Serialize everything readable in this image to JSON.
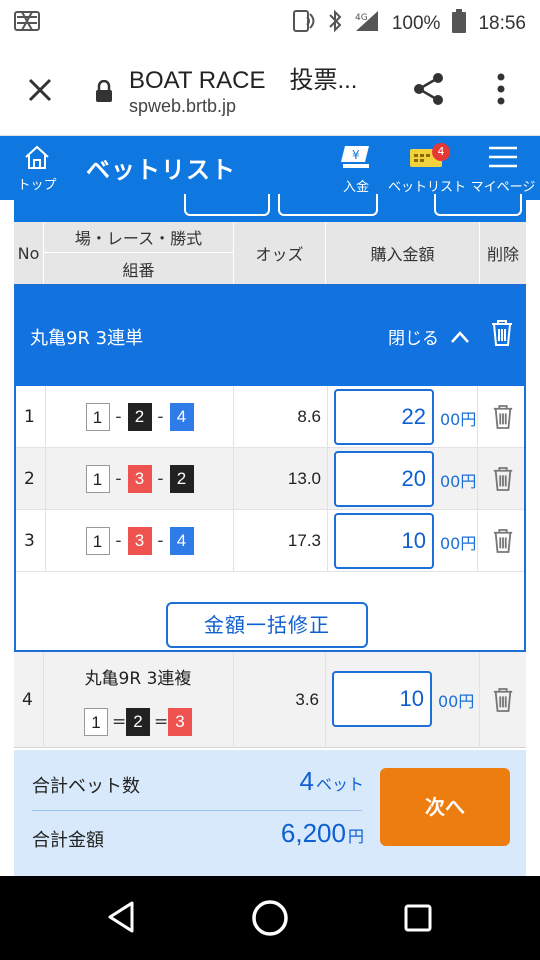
{
  "status_bar": {
    "battery_pct": "100%",
    "clock": "18:56",
    "network": "4G"
  },
  "browser": {
    "title": "BOAT RACE　投票...",
    "url": "spweb.brtb.jp"
  },
  "header": {
    "top_label": "トップ",
    "title": "ベットリスト",
    "deposit_label": "入金",
    "betlist_label": "ベットリスト",
    "betlist_badge": "4",
    "mypage_label": "マイページ"
  },
  "table_head": {
    "no": "No",
    "place_race_type": "場・レース・勝式",
    "combination": "組番",
    "odds": "オッズ",
    "amount": "購入金額",
    "delete": "削除"
  },
  "group": {
    "title": "丸亀9R 3連単",
    "close_label": "閉じる",
    "rows": [
      {
        "no": "1",
        "boats": [
          "1",
          "2",
          "4"
        ],
        "odds": "8.6",
        "amount": "22",
        "unit": "00円"
      },
      {
        "no": "2",
        "boats": [
          "1",
          "3",
          "2"
        ],
        "odds": "13.0",
        "amount": "20",
        "unit": "00円"
      },
      {
        "no": "3",
        "boats": [
          "1",
          "3",
          "4"
        ],
        "odds": "17.3",
        "amount": "10",
        "unit": "00円"
      }
    ],
    "combo_sep": "-",
    "bulk_button": "金額一括修正"
  },
  "row4": {
    "no": "4",
    "title": "丸亀9R 3連複",
    "boats": [
      "1",
      "2",
      "3"
    ],
    "combo_sep": "=",
    "odds": "3.6",
    "amount": "10",
    "unit": "00円"
  },
  "summary": {
    "bet_count_label": "合計ベット数",
    "bet_count": "4",
    "bet_count_unit": "ベット",
    "total_label": "合計金額",
    "total": "6,200",
    "total_unit": "円",
    "next_button": "次へ"
  },
  "colors": {
    "primary": "#0e78e0",
    "next": "#ee7d10",
    "summary_bg": "#d7e9fb",
    "boat_1": "#ffffff",
    "boat_2": "#222222",
    "boat_3": "#ef5350",
    "boat_4": "#2f7be8"
  }
}
